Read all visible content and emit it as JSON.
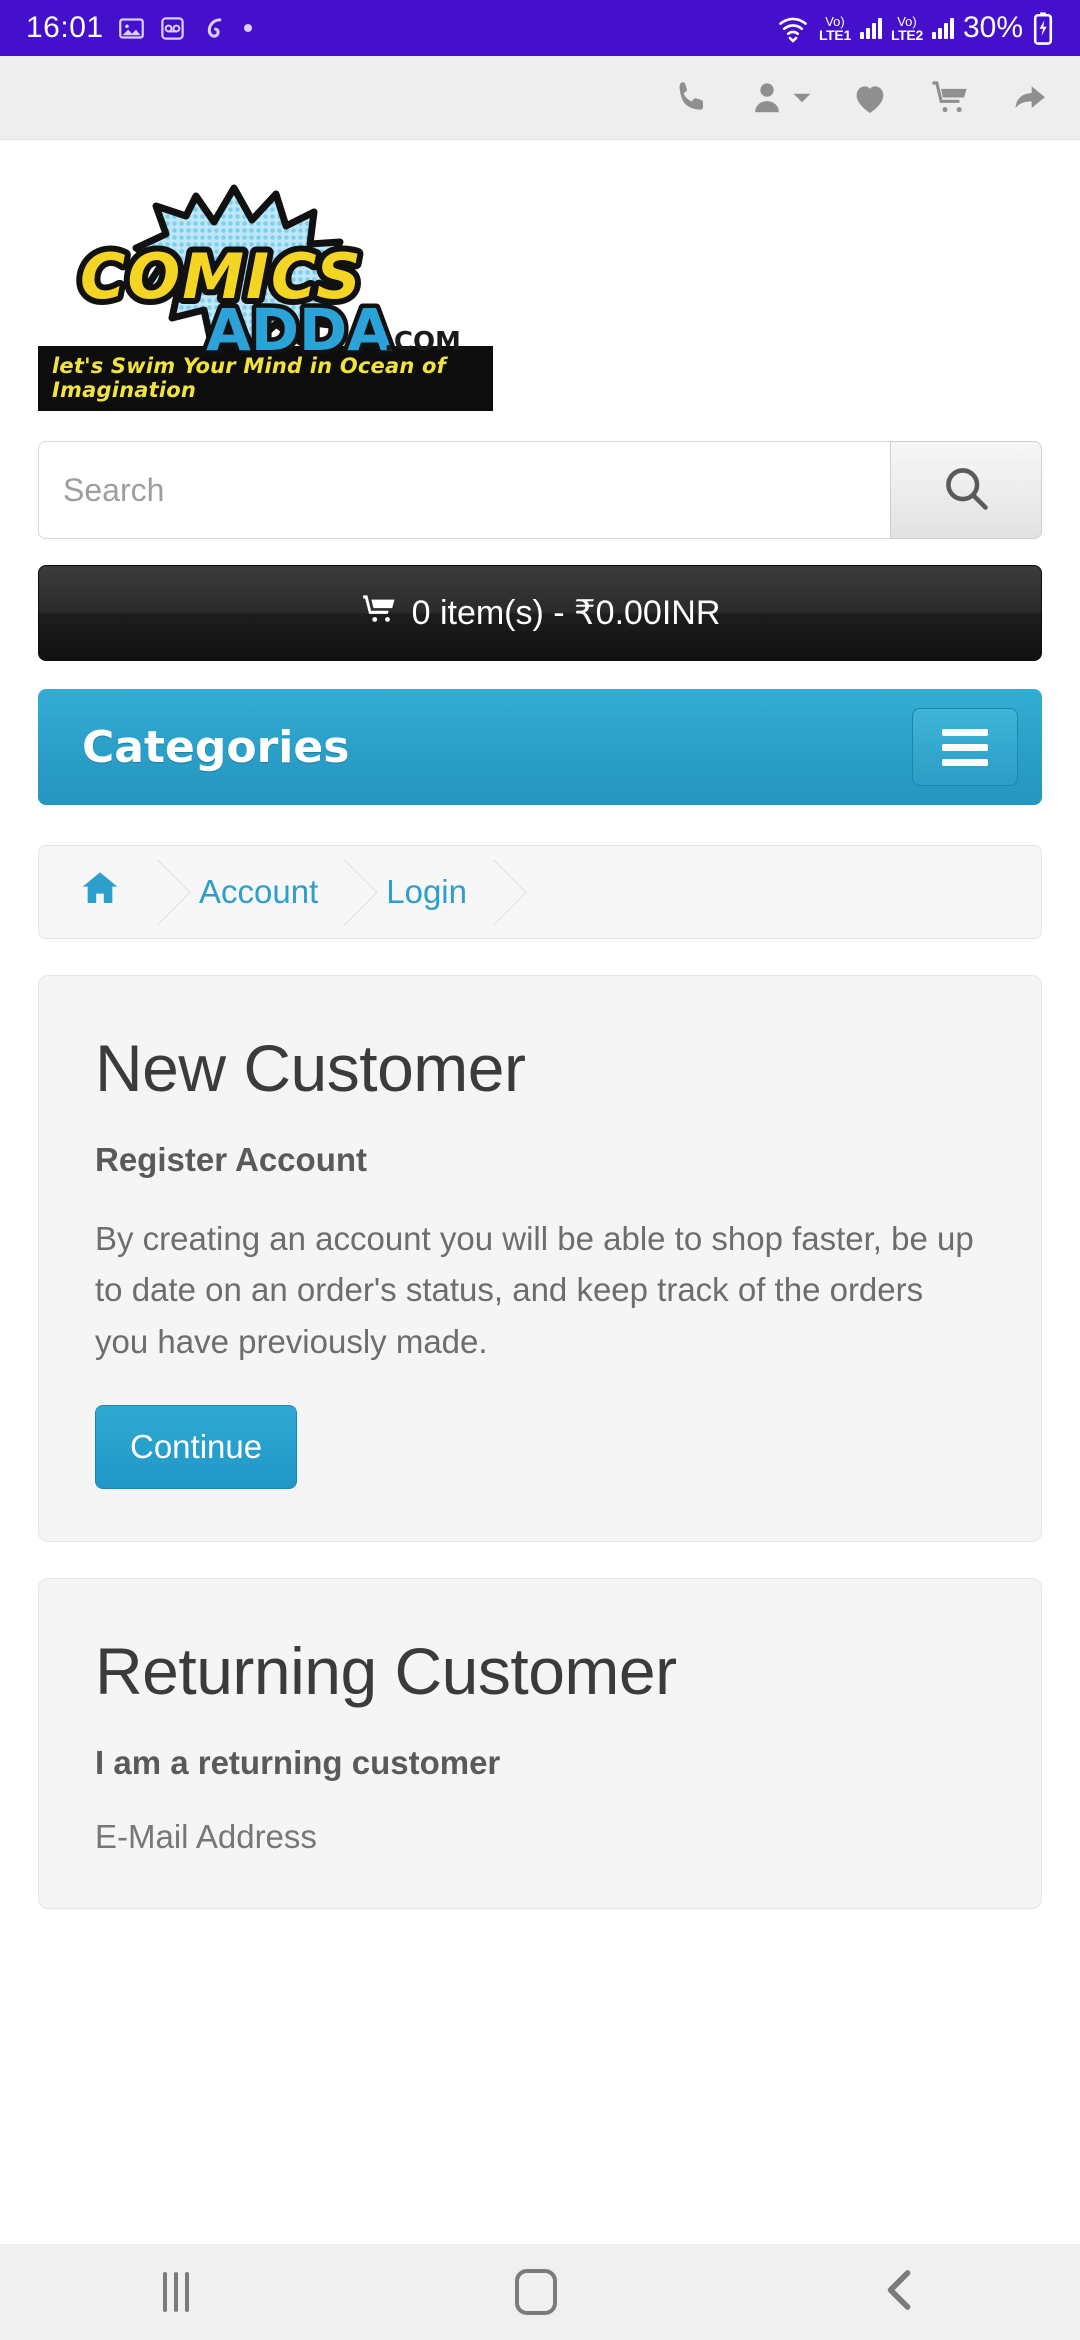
{
  "status_bar": {
    "time": "16:01",
    "battery_percent": "30%",
    "network_1": {
      "voice": "Vo)",
      "label": "LTE1"
    },
    "network_2": {
      "voice": "Vo)",
      "label": "LTE2"
    },
    "icons": [
      "image-icon",
      "voicemail-icon",
      "airtel-icon",
      "dot-icon",
      "wifi-icon",
      "battery-charging-icon"
    ]
  },
  "topbar": {
    "icons": [
      {
        "name": "phone-icon",
        "label": "Call us"
      },
      {
        "name": "user-account-icon",
        "label": "My Account"
      },
      {
        "name": "heart-wishlist-icon",
        "label": "Wish List"
      },
      {
        "name": "shopping-cart-icon",
        "label": "Shopping Cart"
      },
      {
        "name": "checkout-arrow-icon",
        "label": "Checkout"
      }
    ]
  },
  "logo": {
    "word_comics": "COMICS",
    "word_adda": "ADDA",
    "word_dotcom": ".COM",
    "tagline": "let's Swim Your Mind in Ocean of Imagination"
  },
  "search": {
    "placeholder": "Search",
    "value": "",
    "button_icon": "search-icon"
  },
  "cart": {
    "icon": "shopping-cart-icon",
    "summary": "0 item(s) - ₹0.00INR"
  },
  "categories": {
    "title": "Categories",
    "toggle_icon": "hamburger-menu-icon"
  },
  "breadcrumb": {
    "items": [
      {
        "label": "",
        "icon": "home-icon"
      },
      {
        "label": "Account",
        "icon": ""
      },
      {
        "label": "Login",
        "icon": ""
      }
    ]
  },
  "new_customer": {
    "heading": "New Customer",
    "subheading": "Register Account",
    "body": "By creating an account you will be able to shop faster, be up to date on an order's status, and keep track of the orders you have previously made.",
    "button_label": "Continue"
  },
  "returning_customer": {
    "heading": "Returning Customer",
    "subheading": "I am a returning customer",
    "email_label": "E-Mail Address"
  },
  "android_nav": {
    "recent_label": "Recent apps",
    "home_label": "Home",
    "back_label": "Back"
  },
  "colors": {
    "accent_blue": "#2197C8",
    "categories_blue": "#2A9FC8",
    "status_purple": "#4410CC",
    "logo_yellow": "#F2E33C",
    "cart_dark": "#1d1d1d"
  }
}
